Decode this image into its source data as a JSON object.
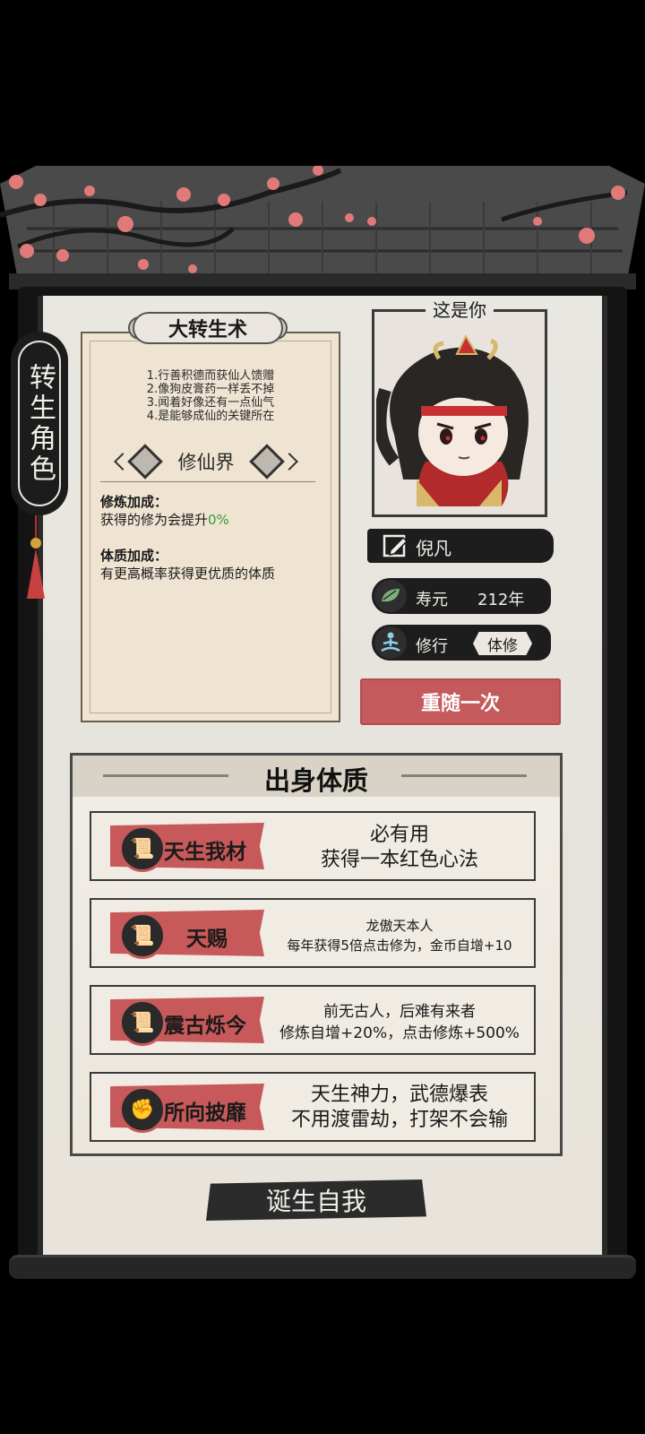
{
  "side_tag": "转生角色",
  "info": {
    "title": "大转生术",
    "lines": [
      "1.行善积德而获仙人馈赠",
      "2.像狗皮膏药一样丢不掉",
      "3.闻着好像还有一点仙气",
      "4.是能够成仙的关键所在"
    ],
    "realm": "修仙界",
    "bonus1_head": "修炼加成：",
    "bonus1_text": "获得的修为会提升",
    "bonus1_value": "0%",
    "bonus2_head": "体质加成：",
    "bonus2_text": "有更高概率获得更优质的体质"
  },
  "portrait": {
    "label": "这是你"
  },
  "stats": {
    "name": "倪凡",
    "life_label": "寿元",
    "life_value": "212年",
    "cult_label": "修行",
    "cult_value": "体修"
  },
  "reroll_label": "重随一次",
  "origin": {
    "title": "出身体质",
    "traits": [
      {
        "name": "天生我材",
        "icon": "scroll-icon",
        "desc1": "必有用",
        "desc2": "获得一本红色心法"
      },
      {
        "name": "天赐",
        "icon": "scroll-icon",
        "desc1": "龙傲天本人",
        "desc2": "每年获得5倍点击修为，金币自增+10"
      },
      {
        "name": "震古烁今",
        "icon": "scroll-icon",
        "desc1": "前无古人，后难有来者",
        "desc2": "修炼自增+20%，点击修炼+500%"
      },
      {
        "name": "所向披靡",
        "icon": "fist-icon",
        "desc1": "天生神力，武德爆表",
        "desc2": "不用渡雷劫，打架不会输"
      }
    ]
  },
  "born_label": "诞生自我",
  "colors": {
    "accent_red": "#c8595a",
    "ink": "#1d1d1d",
    "paper": "#e9e7e1",
    "green": "#3a9a3a"
  }
}
